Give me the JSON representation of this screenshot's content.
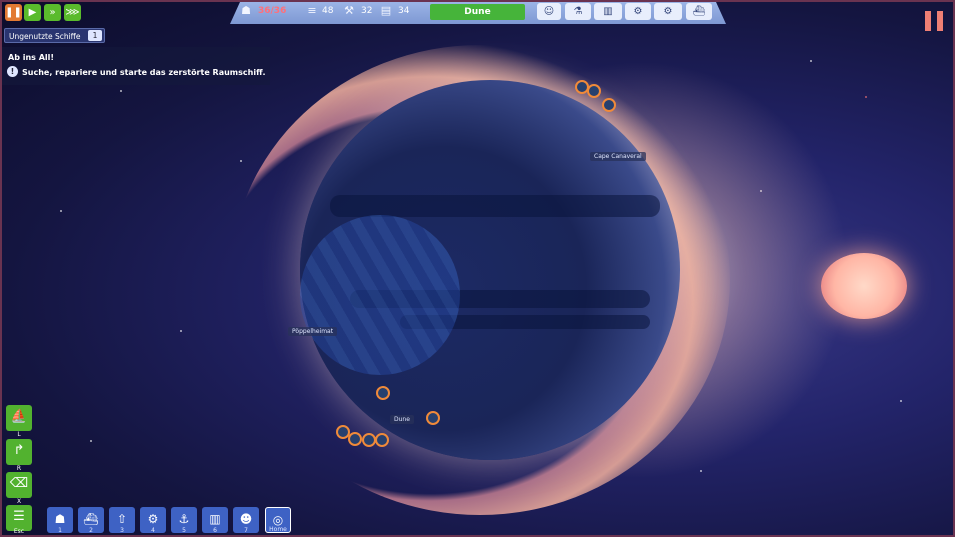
{
  "top_left": {
    "pause_icon": "pause-icon",
    "speed_buttons": [
      "speed-1-icon",
      "speed-2-icon",
      "speed-3-icon"
    ]
  },
  "hud": {
    "population": "36/36",
    "resource_a": "48",
    "resource_b": "32",
    "resource_c": "34",
    "location_button": "Dune",
    "buttons": [
      "mood-icon",
      "research-icon",
      "factory-icon",
      "settings-icon",
      "ship-icon"
    ]
  },
  "left_panel": {
    "unused_ships_label": "Ungenutzte Schiffe",
    "unused_ships_count": "1",
    "quest_title": "Ab ins All!",
    "quest_text": "Suche, repariere und starte das zerstörte Raumschiff.",
    "quest_icon_glyph": "!"
  },
  "map_labels": {
    "cape": "Cape Canaveral",
    "home": "Pöppelheimat",
    "dune": "Dune"
  },
  "side_tools": [
    {
      "icon": "boat-icon",
      "key": "L"
    },
    {
      "icon": "road-icon",
      "key": "R"
    },
    {
      "icon": "demolish-icon",
      "key": "X"
    },
    {
      "icon": "menu-icon",
      "key": "Esc"
    }
  ],
  "build_bar": [
    {
      "icon": "population-icon",
      "key": "1"
    },
    {
      "icon": "boat-build-icon",
      "key": "2"
    },
    {
      "icon": "rocket-icon",
      "key": "3"
    },
    {
      "icon": "gears-icon",
      "key": "4"
    },
    {
      "icon": "harbor-icon",
      "key": "5"
    },
    {
      "icon": "factory-icon",
      "key": "6"
    },
    {
      "icon": "worker-icon",
      "key": "7"
    },
    {
      "icon": "focus-icon",
      "key": "Home"
    }
  ],
  "colors": {
    "accent_orange": "#e27a33",
    "green": "#46b43a",
    "blue_button": "#3e62c4",
    "hud_blue": "#8aa4dc"
  }
}
